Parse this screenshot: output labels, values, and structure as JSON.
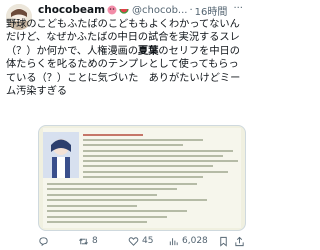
{
  "post": {
    "display_name": "chocobeam",
    "handle": "@chocob...",
    "separator": "·",
    "time": "16時間",
    "more_label": "···",
    "body": {
      "part1": "野球のこどもふたばのこどももよくわかってないんだけど、なぜかふたばの中日の試合を実況するスレ（？）か何かで、人権漫画の",
      "bold": "夏葉",
      "part2": "のセリフを中日の体たらくを叱るためのテンプレとして使ってもらっている（？）ことに気づいた　ありがたいけどミーム汚染すぎる"
    },
    "actions": {
      "reply_count": "",
      "retweet_count": "8",
      "like_count": "45",
      "view_count": "6,028"
    }
  },
  "colors": {
    "text": "#0f1419",
    "muted": "#536471",
    "border": "#cfd9de"
  },
  "icons": {
    "avatar": "avatar-image",
    "reply": "reply-icon",
    "retweet": "retweet-icon",
    "like": "heart-icon",
    "views": "views-chart-icon",
    "bookmark": "bookmark-icon",
    "share": "share-icon",
    "emoji1": "pink-blob-emoji",
    "emoji2": "watermelon-emoji"
  }
}
